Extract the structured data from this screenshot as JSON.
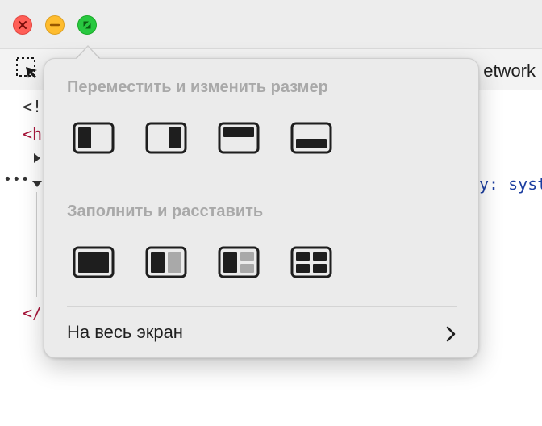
{
  "window": {
    "traffic_lights": {
      "close_color": "#ff5f57",
      "minimize_color": "#febc2e",
      "zoom_color": "#28c840"
    }
  },
  "toolbar": {
    "network_tab_label": "etwork"
  },
  "code": {
    "line1": "<!",
    "line2": "<h",
    "line3_trailing": "y: syst",
    "line4": "</"
  },
  "popover": {
    "move_resize_title": "Переместить и изменить размер",
    "move_resize_buttons": [
      "left-half",
      "right-half",
      "top-half",
      "bottom-half"
    ],
    "fill_arrange_title": "Заполнить и расставить",
    "fill_arrange_buttons": [
      "fill",
      "split-halves",
      "split-main-two",
      "quarters"
    ],
    "fullscreen_label": "На весь экран",
    "fullscreen_icon": "chevron-right-icon"
  }
}
